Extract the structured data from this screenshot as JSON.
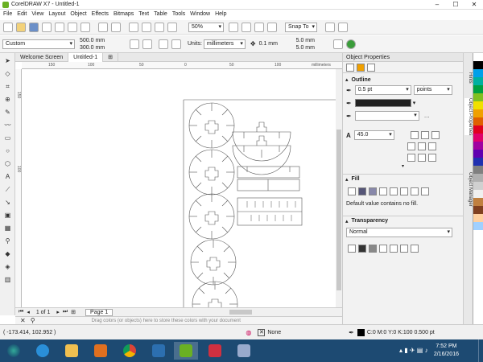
{
  "window": {
    "title": "CorelDRAW X7 - Untitled-1"
  },
  "menu": [
    "File",
    "Edit",
    "View",
    "Layout",
    "Object",
    "Effects",
    "Bitmaps",
    "Text",
    "Table",
    "Tools",
    "Window",
    "Help"
  ],
  "toolbar": {
    "zoom": "50%",
    "snap_to": "Snap To"
  },
  "propbar": {
    "page_preset": "Custom",
    "width": "500.0 mm",
    "height": "300.0 mm",
    "units_label": "Units:",
    "units": "millimeters",
    "nudge": "0.1 mm",
    "dup_x": "5.0 mm",
    "dup_y": "5.0 mm"
  },
  "doc_tabs": [
    "Welcome Screen",
    "Untitled-1"
  ],
  "ruler": {
    "unit": "millimeters",
    "ticks": [
      "150",
      "100",
      "50",
      "0",
      "50",
      "100",
      "150"
    ],
    "vticks": [
      "150",
      "100"
    ]
  },
  "pagebar": {
    "counter": "1 of 1",
    "page_tab": "Page 1"
  },
  "palette_hint": "Drag colors (or objects) here to store these colors with your document",
  "properties": {
    "title": "Object Properties",
    "outline_label": "Outline",
    "outline_width": "0.5 pt",
    "outline_units": "points",
    "miter": "45.0",
    "fill_label": "Fill",
    "fill_message": "Default value contains no fill.",
    "transparency_label": "Transparency",
    "transparency_mode": "Normal"
  },
  "docker_tabs": [
    "Hints",
    "Object Properties",
    "Object Manager"
  ],
  "status": {
    "coords": "( -173.414, 102.952 )",
    "fill_none": "None",
    "outline_info": "C:0 M:0 Y:0 K:100  0.500 pt"
  },
  "clock": {
    "time": "7:52 PM",
    "date": "2/16/2016"
  },
  "colors": {
    "accent": "#6ab023",
    "taskbar": "#1d4a72",
    "palette": [
      "#ffffff",
      "#000000",
      "#00a0e9",
      "#00b0a0",
      "#00a040",
      "#80c020",
      "#f0e000",
      "#f0a000",
      "#e06000",
      "#e00020",
      "#e0006a",
      "#a000a0",
      "#6000b0",
      "#2030b0",
      "#808080",
      "#b0b0b0",
      "#d0d0d0",
      "#f0f0f0",
      "#c08040",
      "#804020",
      "#ffd0a0",
      "#a0d0ff"
    ]
  }
}
